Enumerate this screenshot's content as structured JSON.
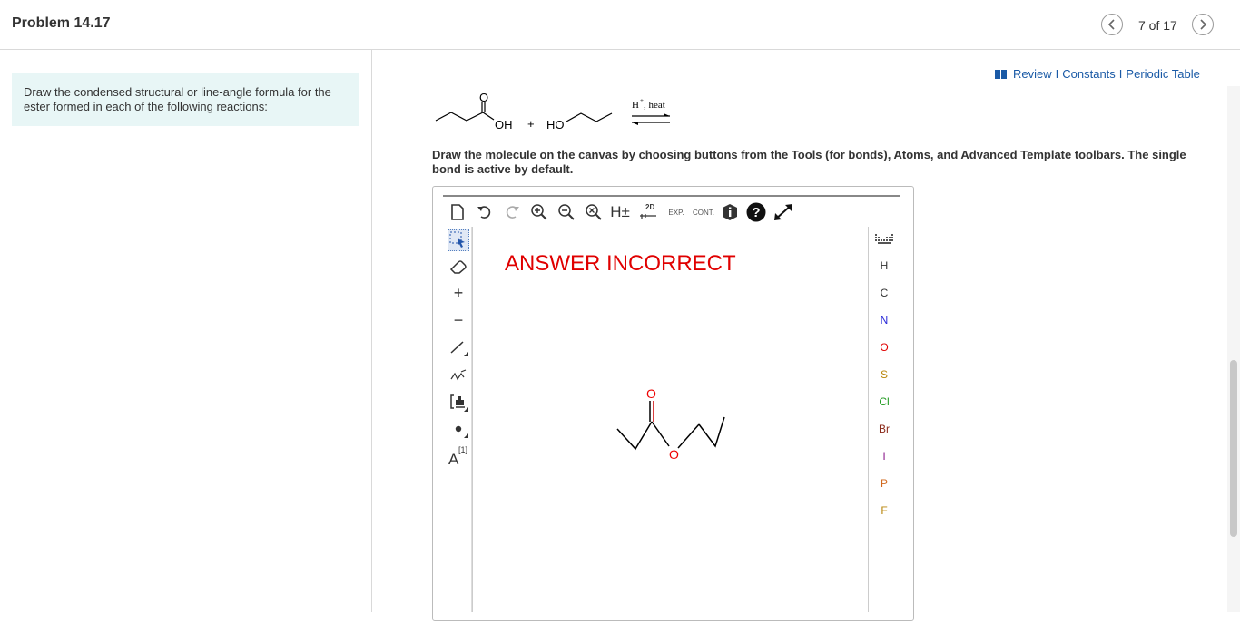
{
  "header": {
    "title": "Problem 14.17",
    "counter": "7 of 17",
    "prev_icon": "chevron-left-icon",
    "next_icon": "chevron-right-icon"
  },
  "instructions": "Draw the condensed structural or line-angle formula for the ester formed in each of the following reactions:",
  "resources": {
    "icon": "book-icon",
    "review": "Review",
    "constants": "Constants",
    "periodic_table": "Periodic Table",
    "separator": "I"
  },
  "reaction": {
    "acid_oxygen": "O",
    "acid_oh": "OH",
    "plus": "+",
    "alcohol_ho": "HO",
    "condition_h": "H",
    "condition_plus": "+",
    "condition_heat": ", heat"
  },
  "draw_instructions": "Draw the molecule on the canvas by choosing buttons from the Tools (for bonds), Atoms, and Advanced Template toolbars. The single bond is active by default.",
  "editor": {
    "top_tools": [
      "new-document-icon",
      "undo-icon",
      "redo-icon",
      "zoom-in-icon",
      "zoom-out-icon",
      "zoom-reset-icon",
      "explicit-hydrogen-icon",
      "clean-2d-icon",
      "expand-icon",
      "contract-icon",
      "info-icon",
      "help-icon",
      "fullscreen-icon"
    ],
    "hydrogen_label": "H±",
    "clean_label": "2D",
    "exp_label": "EXP.",
    "cont_label": "CONT.",
    "left_tools": [
      "select-icon",
      "eraser-icon",
      "charge-plus-icon",
      "charge-minus-icon",
      "single-bond-icon",
      "chain-icon",
      "template-icon",
      "radical-icon",
      "atom-map-icon"
    ],
    "plus_label": "+",
    "minus_label": "−",
    "atom_map_letter": "A",
    "atom_map_index": "[1]",
    "feedback": "ANSWER INCORRECT",
    "drawn_oxygen_carbonyl": "O",
    "drawn_oxygen_ester": "O",
    "periodic_table_icon": "periodic-table-icon",
    "atoms": [
      {
        "symbol": "H",
        "color": "#333333"
      },
      {
        "symbol": "C",
        "color": "#333333"
      },
      {
        "symbol": "N",
        "color": "#2a2ad8"
      },
      {
        "symbol": "O",
        "color": "#e00000"
      },
      {
        "symbol": "S",
        "color": "#b8860b"
      },
      {
        "symbol": "Cl",
        "color": "#1f9a1f"
      },
      {
        "symbol": "Br",
        "color": "#8b2a1a"
      },
      {
        "symbol": "I",
        "color": "#8b1a8b"
      },
      {
        "symbol": "P",
        "color": "#d2691e"
      },
      {
        "symbol": "F",
        "color": "#b8860b"
      }
    ]
  },
  "colors": {
    "feedback": "#e00000",
    "link": "#1a5aa6",
    "instruction_bg": "#e8f6f6"
  }
}
